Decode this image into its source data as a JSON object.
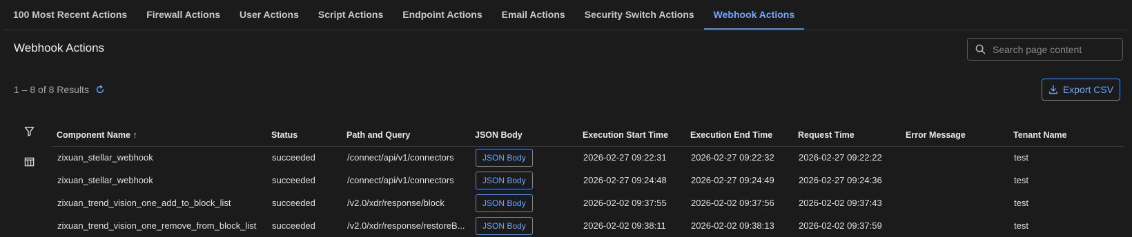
{
  "tabs": [
    {
      "label": "100 Most Recent Actions",
      "active": false
    },
    {
      "label": "Firewall Actions",
      "active": false
    },
    {
      "label": "User Actions",
      "active": false
    },
    {
      "label": "Script Actions",
      "active": false
    },
    {
      "label": "Endpoint Actions",
      "active": false
    },
    {
      "label": "Email Actions",
      "active": false
    },
    {
      "label": "Security Switch Actions",
      "active": false
    },
    {
      "label": "Webhook Actions",
      "active": true
    }
  ],
  "page": {
    "title": "Webhook Actions"
  },
  "search": {
    "placeholder": "Search page content",
    "icon": "search-icon"
  },
  "results": {
    "summary": "1 – 8 of 8 Results",
    "refresh_icon": "refresh-icon"
  },
  "export": {
    "label": "Export CSV",
    "icon": "download-icon"
  },
  "toolbar": {
    "filter_icon": "filter-icon",
    "columns_icon": "columns-icon"
  },
  "colors": {
    "background": "#1b1b1b",
    "accent": "#4f8de8",
    "accent_text": "#6ea8fe"
  },
  "table": {
    "headers": [
      {
        "label": "Component Name",
        "sort": "ascending",
        "sort_icon": "arrow-up-icon"
      },
      {
        "label": "Status"
      },
      {
        "label": "Path and Query"
      },
      {
        "label": "JSON Body"
      },
      {
        "label": "Execution Start Time"
      },
      {
        "label": "Execution End Time"
      },
      {
        "label": "Request Time"
      },
      {
        "label": "Error Message"
      },
      {
        "label": "Tenant Name"
      }
    ],
    "rows": [
      {
        "component": "zixuan_stellar_webhook",
        "status": "succeeded",
        "path": "/connect/api/v1/connectors",
        "json": "JSON Body",
        "start": "2026-02-27 09:22:31",
        "end": "2026-02-27 09:22:32",
        "request": "2026-02-27 09:22:22",
        "error": "",
        "tenant": "test"
      },
      {
        "component": "zixuan_stellar_webhook",
        "status": "succeeded",
        "path": "/connect/api/v1/connectors",
        "json": "JSON Body",
        "start": "2026-02-27 09:24:48",
        "end": "2026-02-27 09:24:49",
        "request": "2026-02-27 09:24:36",
        "error": "",
        "tenant": "test"
      },
      {
        "component": "zixuan_trend_vision_one_add_to_block_list",
        "status": "succeeded",
        "path": "/v2.0/xdr/response/block",
        "json": "JSON Body",
        "start": "2026-02-02 09:37:55",
        "end": "2026-02-02 09:37:56",
        "request": "2026-02-02 09:37:43",
        "error": "",
        "tenant": "test"
      },
      {
        "component": "zixuan_trend_vision_one_remove_from_block_list",
        "status": "succeeded",
        "path": "/v2.0/xdr/response/restoreB...",
        "json": "JSON Body",
        "start": "2026-02-02 09:38:11",
        "end": "2026-02-02 09:38:13",
        "request": "2026-02-02 09:37:59",
        "error": "",
        "tenant": "test"
      }
    ]
  }
}
